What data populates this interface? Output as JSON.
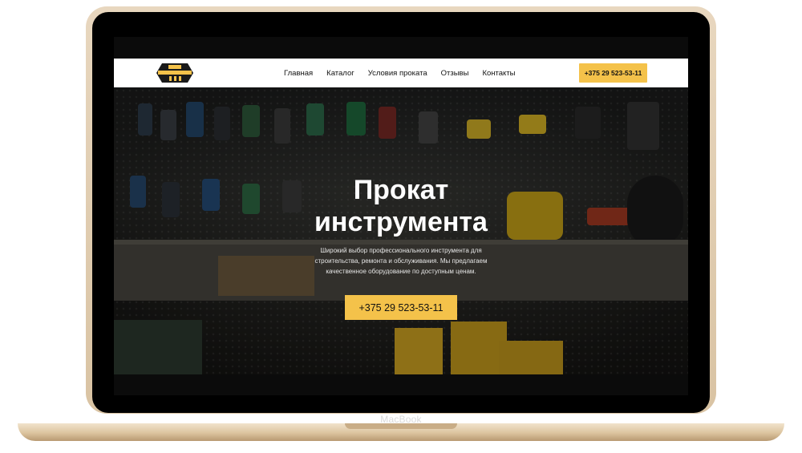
{
  "device": {
    "label": "MacBook"
  },
  "site": {
    "logo_text": "ПРОКАТ ИНСТРУМЕНТА",
    "nav": [
      {
        "label": "Главная"
      },
      {
        "label": "Каталог"
      },
      {
        "label": "Условия проката"
      },
      {
        "label": "Отзывы"
      },
      {
        "label": "Контакты"
      }
    ],
    "header_phone": "+375 29 523-53-11",
    "hero": {
      "title_line1": "Прокат",
      "title_line2": "инструмента",
      "description": "Широкий выбор профессионального инструмента для строительства, ремонта и обслуживания. Мы предлагаем качественное оборудование по доступным ценам.",
      "cta_phone": "+375 29 523-53-11"
    }
  },
  "colors": {
    "accent": "#f4c24a",
    "header_bg": "#ffffff",
    "laptop_gold": "#d9c3a3"
  }
}
